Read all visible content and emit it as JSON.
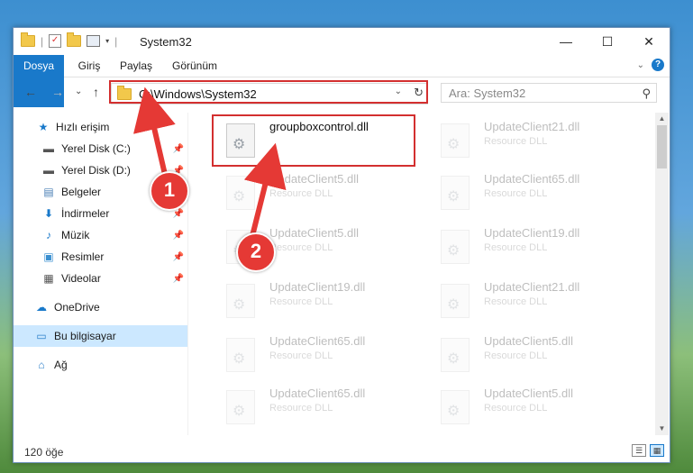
{
  "window": {
    "title": "System32",
    "controls": {
      "minimize": "—",
      "maximize": "☐",
      "close": "✕"
    }
  },
  "ribbon": {
    "tabs": [
      "Dosya",
      "Giriş",
      "Paylaş",
      "Görünüm"
    ],
    "expand_glyph": "⌄",
    "help_glyph": "?"
  },
  "nav": {
    "back": "←",
    "forward": "→",
    "recent": "⌄",
    "up": "↑",
    "address": "C:\\Windows\\System32",
    "search_placeholder": "Ara: System32"
  },
  "sidebar": {
    "items": [
      {
        "label": "Hızlı erişim",
        "icon": "star-icon",
        "pinned": false
      },
      {
        "label": "Yerel Disk (C:)",
        "icon": "drive-icon",
        "pinned": true
      },
      {
        "label": "Yerel Disk (D:)",
        "icon": "drive-icon",
        "pinned": true
      },
      {
        "label": "Belgeler",
        "icon": "documents-icon",
        "pinned": true
      },
      {
        "label": "İndirmeler",
        "icon": "download-icon",
        "pinned": true
      },
      {
        "label": "Müzik",
        "icon": "music-icon",
        "pinned": true
      },
      {
        "label": "Resimler",
        "icon": "pictures-icon",
        "pinned": true
      },
      {
        "label": "Videolar",
        "icon": "videos-icon",
        "pinned": true
      },
      {
        "label": "OneDrive",
        "icon": "onedrive-icon",
        "pinned": false
      },
      {
        "label": "Bu bilgisayar",
        "icon": "computer-icon",
        "pinned": false,
        "selected": true
      },
      {
        "label": "Ağ",
        "icon": "network-icon",
        "pinned": false
      }
    ]
  },
  "files": [
    {
      "name": "groupboxcontrol.dll",
      "type": "",
      "highlight": true
    },
    {
      "name": "UpdateClient21.dll",
      "type": "Resource DLL"
    },
    {
      "name": "UpdateClient5.dll",
      "type": "Resource DLL"
    },
    {
      "name": "UpdateClient65.dll",
      "type": "Resource DLL"
    },
    {
      "name": "UpdateClient5.dll",
      "type": "Resource DLL"
    },
    {
      "name": "UpdateClient19.dll",
      "type": "Resource DLL"
    },
    {
      "name": "UpdateClient19.dll",
      "type": "Resource DLL"
    },
    {
      "name": "UpdateClient21.dll",
      "type": "Resource DLL"
    },
    {
      "name": "UpdateClient65.dll",
      "type": "Resource DLL"
    },
    {
      "name": "UpdateClient5.dll",
      "type": "Resource DLL"
    },
    {
      "name": "UpdateClient65.dll",
      "type": "Resource DLL"
    },
    {
      "name": "UpdateClient5.dll",
      "type": "Resource DLL"
    }
  ],
  "status": {
    "count": "120 öğe"
  },
  "annotations": {
    "step1": "1",
    "step2": "2",
    "color": "#e53935"
  }
}
